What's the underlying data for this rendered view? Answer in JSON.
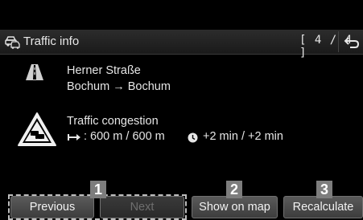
{
  "header": {
    "title": "Traffic info",
    "page_indicator": "[ 4 / 4 ]",
    "title_icon": "car-traffic-icon",
    "back_icon": "back-arrow-icon"
  },
  "road": {
    "icon": "road-icon",
    "street": "Herner Straße",
    "route": "Bochum → Bochum"
  },
  "incident": {
    "icon": "traffic-jam-warning-icon",
    "type": "Traffic congestion",
    "distance_icon": "distance-icon",
    "distance_text": ": 600 m / 600 m",
    "delay_icon": "clock-icon",
    "delay_text": "+2 min / +2 min"
  },
  "buttons": {
    "previous": "Previous",
    "next": "Next",
    "show_on_map": "Show on map",
    "recalculate": "Recalculate"
  },
  "callouts": [
    "1",
    "2",
    "3"
  ],
  "colors": {
    "background": "#000000",
    "header": "#222222",
    "button": "#4a4a4a",
    "callout": "#7d7d7d"
  }
}
